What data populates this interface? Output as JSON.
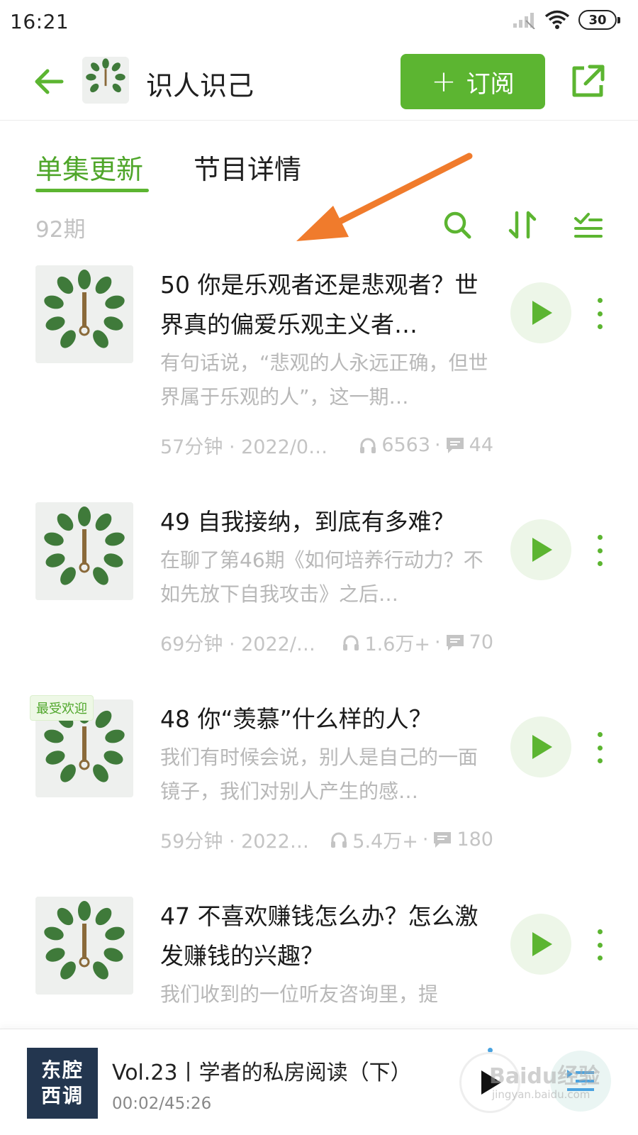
{
  "status_bar": {
    "time": "16:21",
    "battery": "30"
  },
  "header": {
    "title": "识人识己",
    "subscribe_label": "订阅",
    "subscribe_plus": "+"
  },
  "tabs": [
    {
      "label": "单集更新",
      "active": true
    },
    {
      "label": "节目详情",
      "active": false
    }
  ],
  "toolbar": {
    "count": "92期"
  },
  "cover_text": "识人识己",
  "episodes": [
    {
      "badge": "",
      "title": "50 你是乐观者还是悲观者？世界真的偏爱乐观主义者…",
      "desc": "有句话说，“悲观的人永远正确，但世界属于乐观的人”，这一期…",
      "duration_date": "57分钟 · 2022/0…",
      "plays": "6563",
      "comments": "44"
    },
    {
      "badge": "",
      "title": "49 自我接纳，到底有多难？",
      "desc": "在聊了第46期《如何培养行动力？不如先放下自我攻击》之后…",
      "duration_date": "69分钟 · 2022/…",
      "plays": "1.6万+",
      "comments": "70"
    },
    {
      "badge": "最受欢迎",
      "title": "48 你“羡慕”什么样的人？",
      "desc": "我们有时候会说，别人是自己的一面镜子，我们对别人产生的感…",
      "duration_date": "59分钟 · 2022…",
      "plays": "5.4万+",
      "comments": "180"
    },
    {
      "badge": "",
      "title": "47 不喜欢赚钱怎么办？怎么激发赚钱的兴趣？",
      "desc": "我们收到的一位听友咨询里，提",
      "duration_date": "",
      "plays": "",
      "comments": ""
    }
  ],
  "player": {
    "cover_line1": "东腔",
    "cover_line2": "西调",
    "title": "Vol.23丨学者的私房阅读（下）",
    "time": "00:02/45:26"
  },
  "watermark": {
    "main": "Baidu经验",
    "sub": "jingyan.baidu.com"
  },
  "colors": {
    "accent": "#5cb531",
    "accent_text": "#4fa62a",
    "annotation": "#f07b2c",
    "player_cover": "#23364f"
  },
  "icons": [
    "back-arrow-icon",
    "share-icon",
    "search-icon",
    "sort-icon",
    "filter-list-icon",
    "play-icon",
    "more-vertical-icon",
    "headphones-icon",
    "comment-icon",
    "playlist-icon",
    "signal-icon",
    "wifi-icon",
    "battery-icon"
  ]
}
